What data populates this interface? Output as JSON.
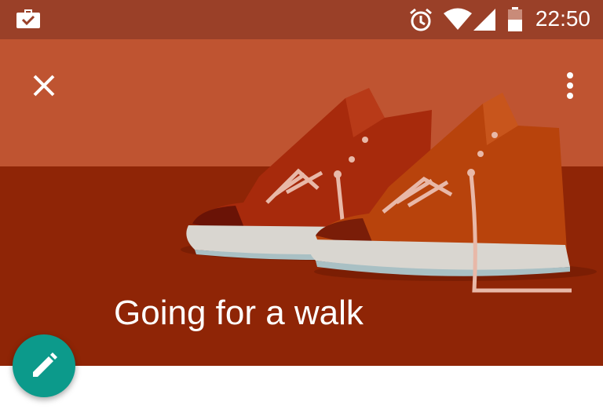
{
  "status_bar": {
    "time": "22:50",
    "icons": [
      "briefcase-check-icon",
      "alarm-icon",
      "wifi-icon",
      "cell-signal-icon",
      "battery-icon"
    ]
  },
  "toolbar": {
    "close_icon": "close-icon",
    "more_icon": "more-vert-icon"
  },
  "hero": {
    "title": "Going for a walk",
    "illustration": "sneakers-illustration"
  },
  "fab": {
    "icon": "pencil-icon"
  },
  "colors": {
    "status_bar": "#9a4028",
    "hero_top": "#bf5431",
    "hero_bottom": "#8f2506",
    "fab": "#0c9a8b"
  }
}
